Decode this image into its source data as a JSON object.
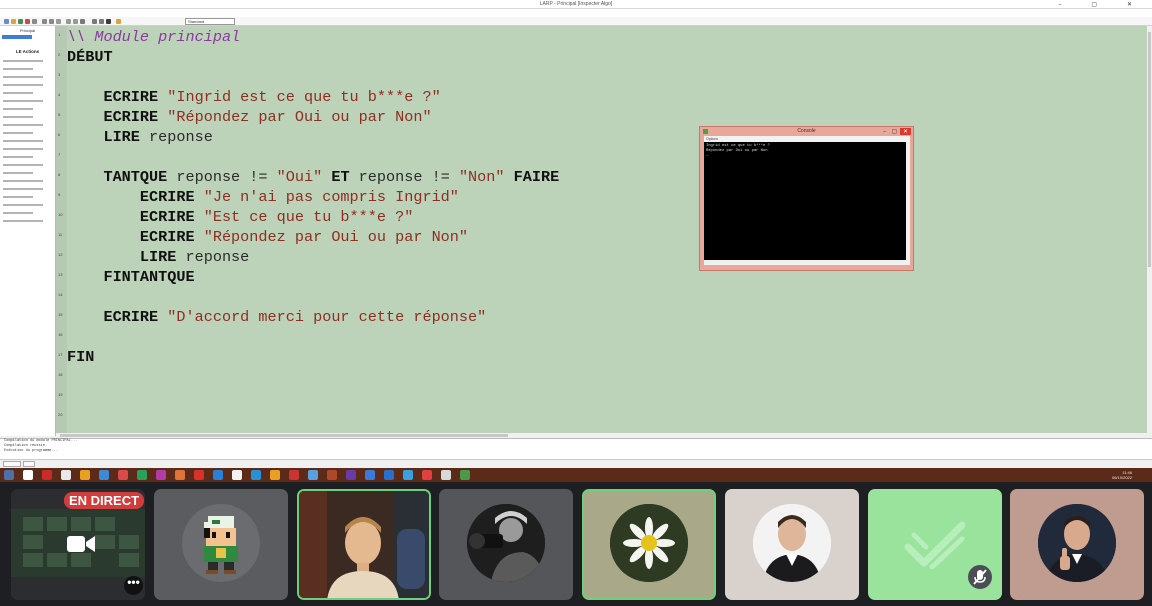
{
  "ide": {
    "window_title": "LARP - Principal [Inspecter Algo]",
    "window_buttons": "– ▢ ✕",
    "menu": [
      "Fichier",
      "Édition",
      "Affichage",
      "Exécuter",
      "Projet",
      "Options",
      "Aide"
    ],
    "toolbar_combo": "Standard",
    "left_panel": {
      "header": "Principal",
      "item": "Module principal",
      "title": "LE Actions"
    },
    "code_lines": [
      [
        {
          "t": "\\\\ Module principal",
          "c": "cmt"
        }
      ],
      [
        {
          "t": "DÉBUT",
          "c": "kw"
        }
      ],
      [],
      [
        {
          "t": "    ECRIRE ",
          "c": "kw"
        },
        {
          "t": "\"Ingrid est ce que tu b***e ?\"",
          "c": "str"
        }
      ],
      [
        {
          "t": "    ECRIRE ",
          "c": "kw"
        },
        {
          "t": "\"Répondez par Oui ou par Non\"",
          "c": "str"
        }
      ],
      [
        {
          "t": "    LIRE ",
          "c": "kw"
        },
        {
          "t": "reponse",
          "c": "txt"
        }
      ],
      [],
      [
        {
          "t": "    TANTQUE ",
          "c": "kw"
        },
        {
          "t": "reponse != ",
          "c": "txt"
        },
        {
          "t": "\"Oui\" ",
          "c": "str"
        },
        {
          "t": "ET ",
          "c": "kw"
        },
        {
          "t": "reponse != ",
          "c": "txt"
        },
        {
          "t": "\"Non\" ",
          "c": "str"
        },
        {
          "t": "FAIRE",
          "c": "kw"
        }
      ],
      [
        {
          "t": "        ECRIRE ",
          "c": "kw"
        },
        {
          "t": "\"Je n'ai pas compris Ingrid\"",
          "c": "str"
        }
      ],
      [
        {
          "t": "        ECRIRE ",
          "c": "kw"
        },
        {
          "t": "\"Est ce que tu b***e ?\"",
          "c": "str"
        }
      ],
      [
        {
          "t": "        ECRIRE ",
          "c": "kw"
        },
        {
          "t": "\"Répondez par Oui ou par Non\"",
          "c": "str"
        }
      ],
      [
        {
          "t": "        LIRE ",
          "c": "kw"
        },
        {
          "t": "reponse",
          "c": "txt"
        }
      ],
      [
        {
          "t": "    FINTANTQUE",
          "c": "kw"
        }
      ],
      [],
      [
        {
          "t": "    ECRIRE ",
          "c": "kw"
        },
        {
          "t": "\"D'accord merci pour cette réponse\"",
          "c": "str"
        }
      ],
      [],
      [
        {
          "t": "FIN",
          "c": "kw"
        }
      ]
    ],
    "console_lines": [
      "Compilation du module PRINCIPAL...",
      "Compilation réussie.",
      "Exécution du programme..."
    ]
  },
  "popup": {
    "title": "Console",
    "menu": "Options",
    "output": [
      "Ingrid est ce que tu b***e ?",
      "Répondez par Oui ou par Non",
      "_"
    ]
  },
  "taskbar": {
    "time": "11:46",
    "date": "06/10/2022"
  },
  "call": {
    "live_label": "EN DIRECT",
    "more_label": "•••",
    "accent_speaking": "#6dd07a"
  }
}
